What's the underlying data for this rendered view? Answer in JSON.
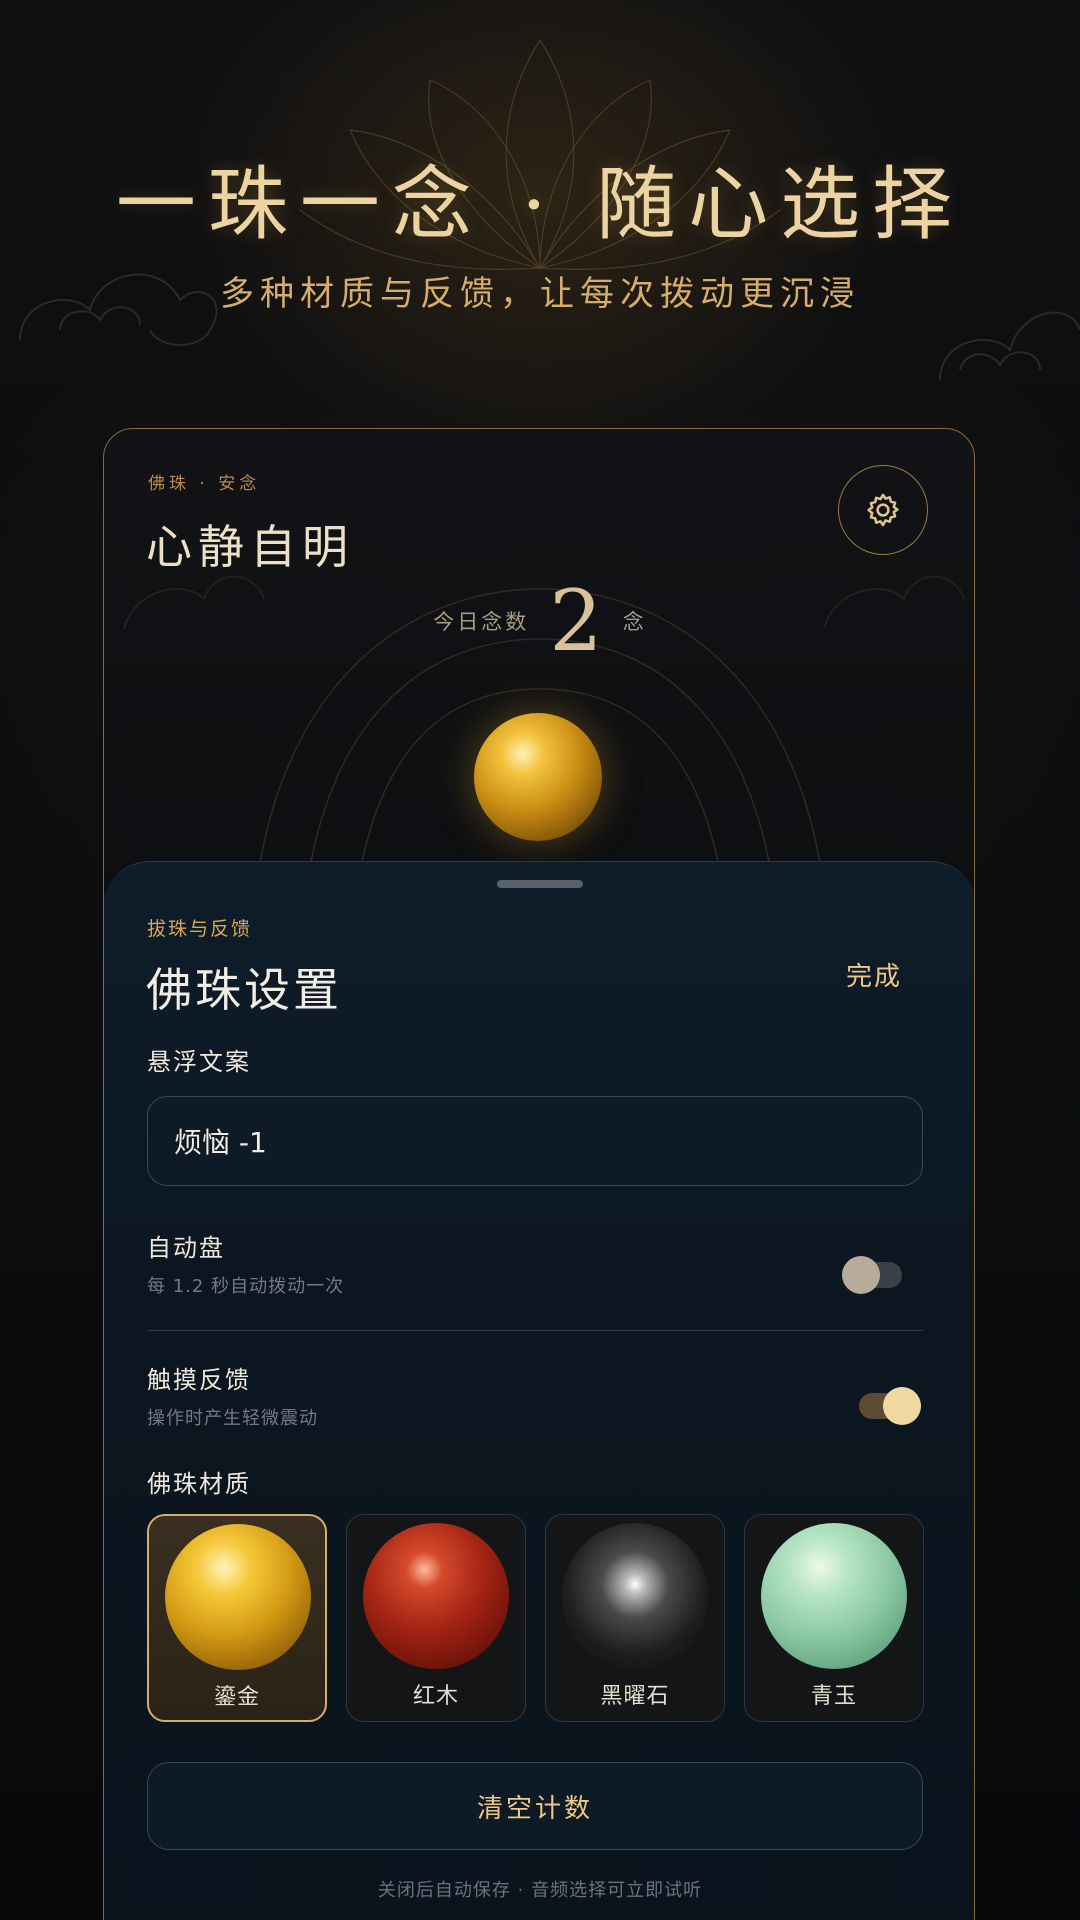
{
  "hero": {
    "title": "一珠一念 · 随心选择",
    "subtitle": "多种材质与反馈，让每次拨动更沉浸"
  },
  "card": {
    "kicker": "佛珠 · 安念",
    "title": "心静自明",
    "count_label": "今日念数",
    "count_value": "2",
    "count_unit": "念",
    "settings_icon": "gear-icon"
  },
  "sheet": {
    "kicker": "拔珠与反馈",
    "title": "佛珠设置",
    "done_label": "完成",
    "floating_text": {
      "label": "悬浮文案",
      "value": "烦恼 -1"
    },
    "auto": {
      "title": "自动盘",
      "subtitle": "每 1.2 秒自动拨动一次",
      "enabled": false
    },
    "haptic": {
      "title": "触摸反馈",
      "subtitle": "操作时产生轻微震动",
      "enabled": true
    },
    "material_label": "佛珠材质",
    "materials": [
      {
        "label": "鎏金",
        "selected": true
      },
      {
        "label": "红木",
        "selected": false
      },
      {
        "label": "黑曜石",
        "selected": false
      },
      {
        "label": "青玉",
        "selected": false
      }
    ],
    "clear_label": "清空计数",
    "footer": "关闭后自动保存 · 音频选择可立即试听"
  },
  "colors": {
    "accent_gold": "#edc989",
    "sheet_bg": "#0b1620"
  }
}
